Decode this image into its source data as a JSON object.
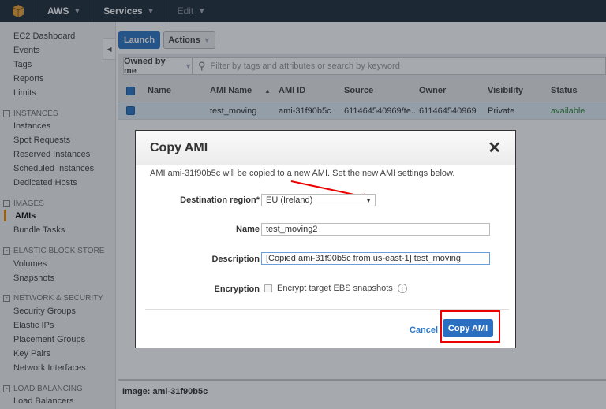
{
  "topnav": {
    "brand": "AWS",
    "services": "Services",
    "edit": "Edit"
  },
  "sidebar": {
    "items": [
      {
        "label": "EC2 Dashboard"
      },
      {
        "label": "Events"
      },
      {
        "label": "Tags"
      },
      {
        "label": "Reports"
      },
      {
        "label": "Limits"
      }
    ],
    "sections": [
      {
        "title": "INSTANCES",
        "items": [
          "Instances",
          "Spot Requests",
          "Reserved Instances",
          "Scheduled Instances",
          "Dedicated Hosts"
        ]
      },
      {
        "title": "IMAGES",
        "items": [
          "AMIs",
          "Bundle Tasks"
        ]
      },
      {
        "title": "ELASTIC BLOCK STORE",
        "items": [
          "Volumes",
          "Snapshots"
        ]
      },
      {
        "title": "NETWORK & SECURITY",
        "items": [
          "Security Groups",
          "Elastic IPs",
          "Placement Groups",
          "Key Pairs",
          "Network Interfaces"
        ]
      },
      {
        "title": "LOAD BALANCING",
        "items": [
          "Load Balancers"
        ]
      }
    ],
    "active": "AMIs"
  },
  "toolbar": {
    "launch": "Launch",
    "actions": "Actions"
  },
  "filter": {
    "owned": "Owned by me",
    "placeholder": "Filter by tags and attributes or search by keyword"
  },
  "table": {
    "columns": [
      "Name",
      "AMI Name",
      "AMI ID",
      "Source",
      "Owner",
      "Visibility",
      "Status"
    ],
    "rows": [
      {
        "name": "",
        "ami_name": "test_moving",
        "ami_id": "ami-31f90b5c",
        "source": "611464540969/te...",
        "owner": "611464540969",
        "visibility": "Private",
        "status": "available"
      }
    ]
  },
  "bottom": {
    "image_label": "Image: ami-31f90b5c"
  },
  "modal": {
    "title": "Copy AMI",
    "intro": "AMI ami-31f90b5c will be copied to a new AMI. Set the new AMI settings below.",
    "dest_label": "Destination region*",
    "dest_value": "EU (Ireland)",
    "name_label": "Name",
    "name_value": "test_moving2",
    "desc_label": "Description",
    "desc_value": "[Copied ami-31f90b5c from us-east-1] test_moving",
    "enc_label": "Encryption",
    "enc_checkbox": "Encrypt target EBS snapshots",
    "cancel": "Cancel",
    "copy": "Copy AMI"
  },
  "colors": {
    "accent": "#2f78c4",
    "annotation": "#e00000",
    "status_available": "#2e8b3a"
  }
}
